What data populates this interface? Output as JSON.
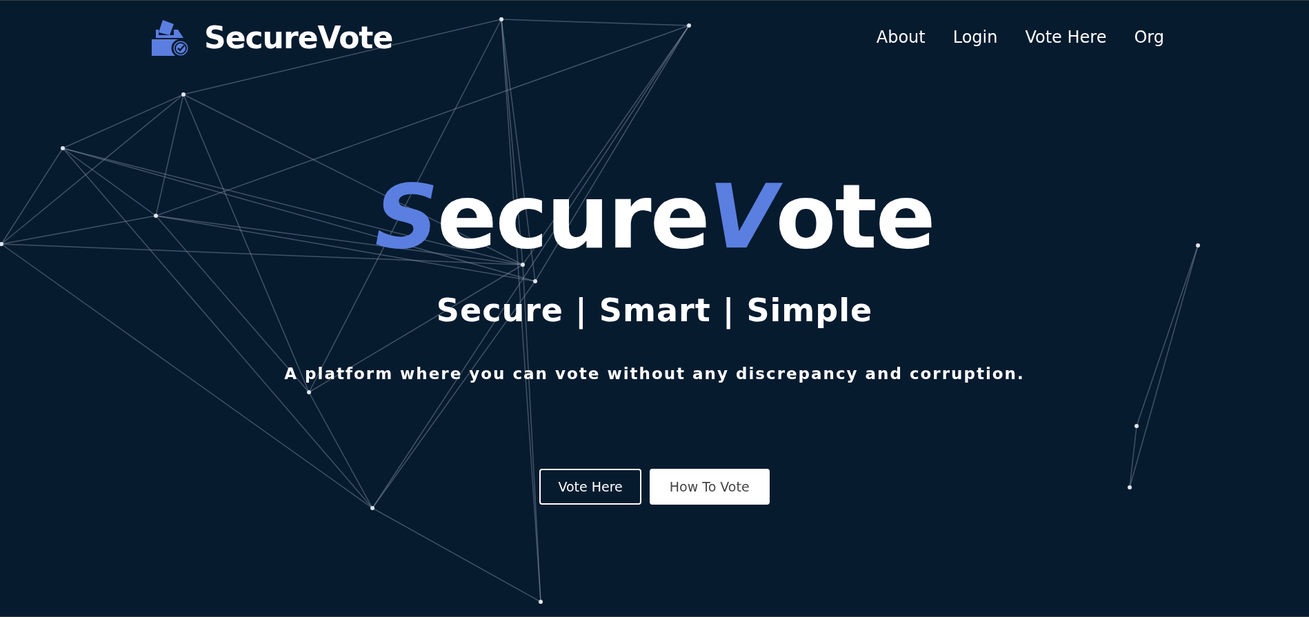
{
  "brand": {
    "name": "SecureVote"
  },
  "nav": [
    {
      "label": "About"
    },
    {
      "label": "Login"
    },
    {
      "label": "Vote Here"
    },
    {
      "label": "Org"
    }
  ],
  "hero": {
    "title": [
      {
        "text": "S",
        "accent": true
      },
      {
        "text": "ecure",
        "accent": false
      },
      {
        "text": "V",
        "accent": true
      },
      {
        "text": "ote",
        "accent": false
      }
    ],
    "subtitle": "Secure | Smart | Simple",
    "tagline": "A platform where you can vote without any discrepancy and corruption.",
    "buttons": [
      {
        "label": "Vote Here",
        "kind": "outline"
      },
      {
        "label": "How To Vote",
        "kind": "solid"
      }
    ]
  }
}
